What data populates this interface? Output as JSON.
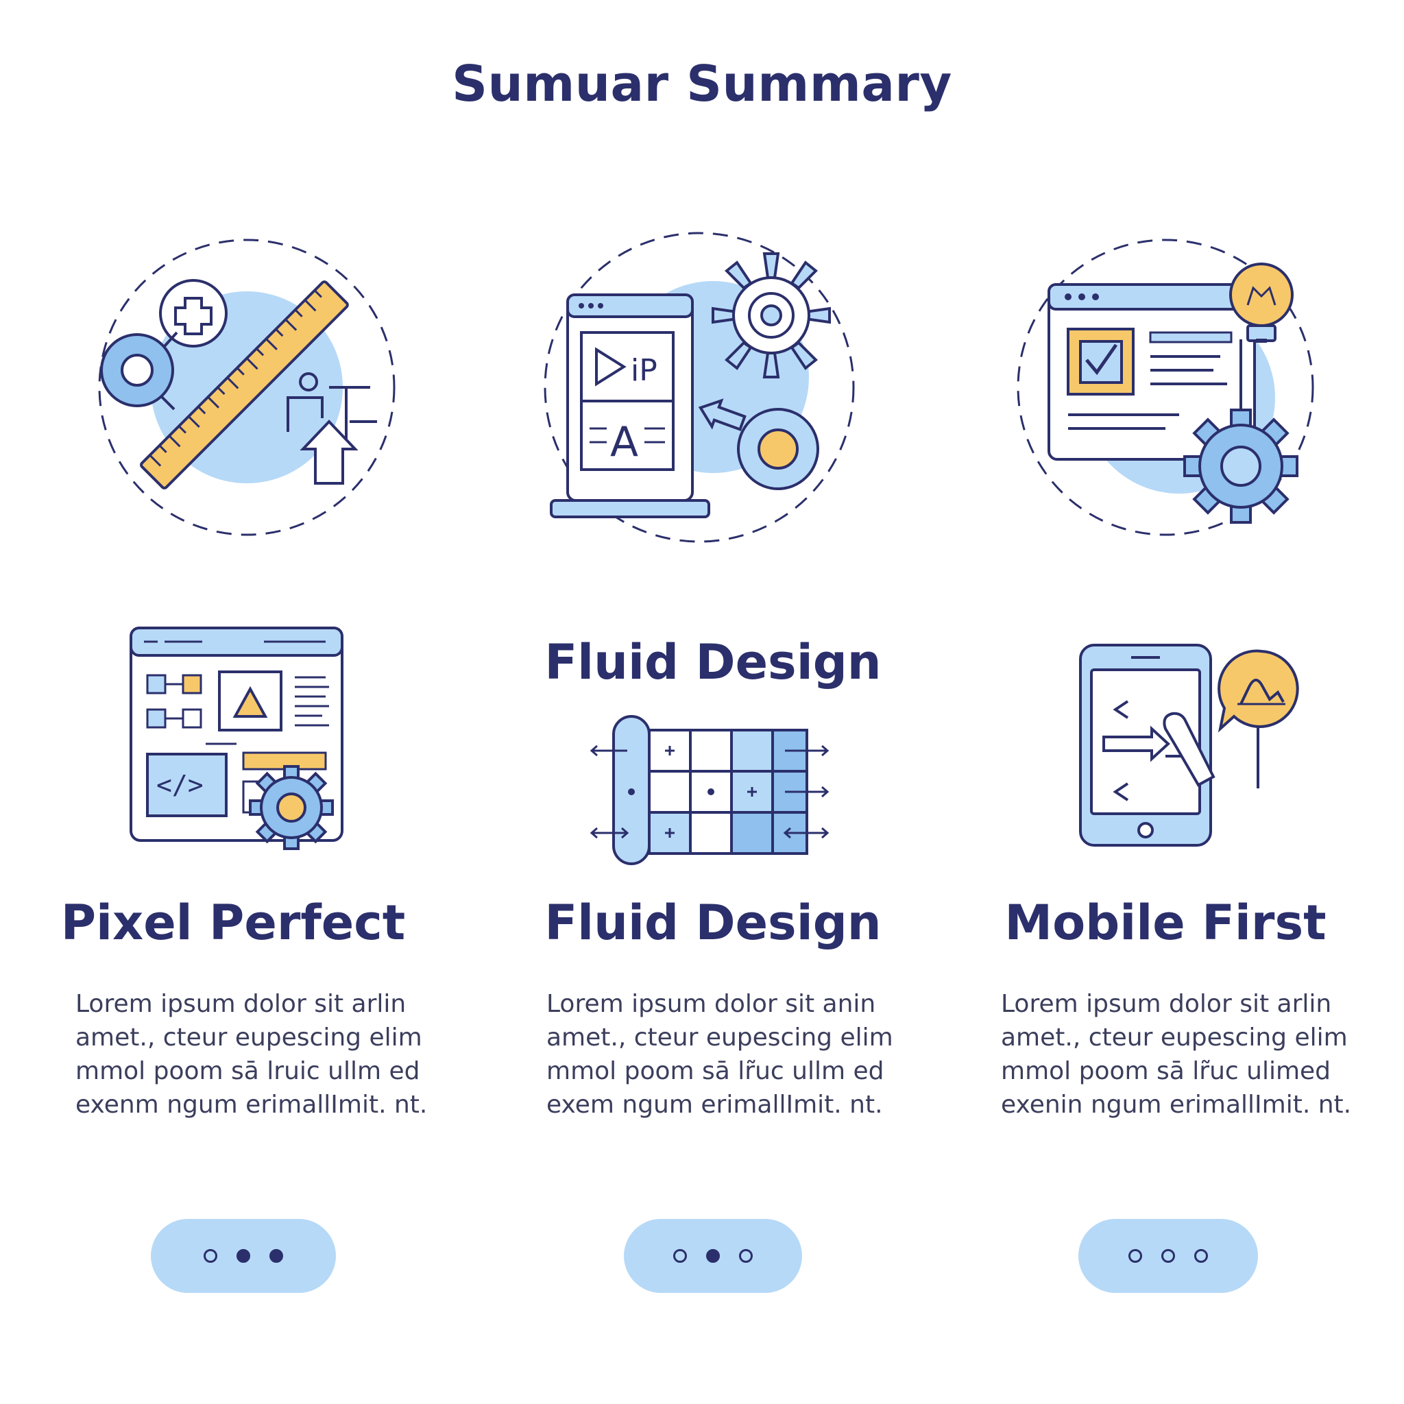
{
  "header": {
    "title": "Sumuar Summary"
  },
  "middle_label": "Fluid Design",
  "cards": [
    {
      "title": "Pixel Perfect",
      "body_lines": [
        "Lorem ipsum dolor sit arlin",
        "amet., cteur eupescing elim",
        "mmol  poom sā lruic ullm ed",
        "exenm ngum erimallImit. nt."
      ],
      "pager": {
        "dots": [
          "outline",
          "filled",
          "filled"
        ]
      }
    },
    {
      "title": "Fluid Design",
      "body_lines": [
        "Lorem ipsum dolor sit anin",
        "amet., cteur eupescing elim",
        "mmol  poom sā lr̃uc ullm ed",
        "exem ngum erimallImit. nt."
      ],
      "pager": {
        "dots": [
          "outline",
          "filled",
          "outline"
        ]
      }
    },
    {
      "title": "Mobile First",
      "body_lines": [
        "Lorem ipsum dolor sit arlin",
        "amet., cteur eupescing elim",
        "mmol  poom sā lr̃uc ulimed",
        "exenin ngum erimallImit. nt."
      ],
      "pager": {
        "dots": [
          "outline",
          "outline",
          "outline"
        ]
      }
    }
  ],
  "icons": {
    "top": [
      "ruler-plus-icon",
      "tablet-gear-icon",
      "browser-checklist-gear-icon"
    ],
    "bottom": [
      "wireframe-code-gear-icon",
      "fluid-grid-icon",
      "mobile-touch-idea-icon"
    ]
  },
  "colors": {
    "navy": "#2b2f6b",
    "light_blue": "#b6d9f7",
    "mid_blue": "#8fc0ee",
    "yellow": "#f7c86a",
    "white": "#ffffff"
  }
}
